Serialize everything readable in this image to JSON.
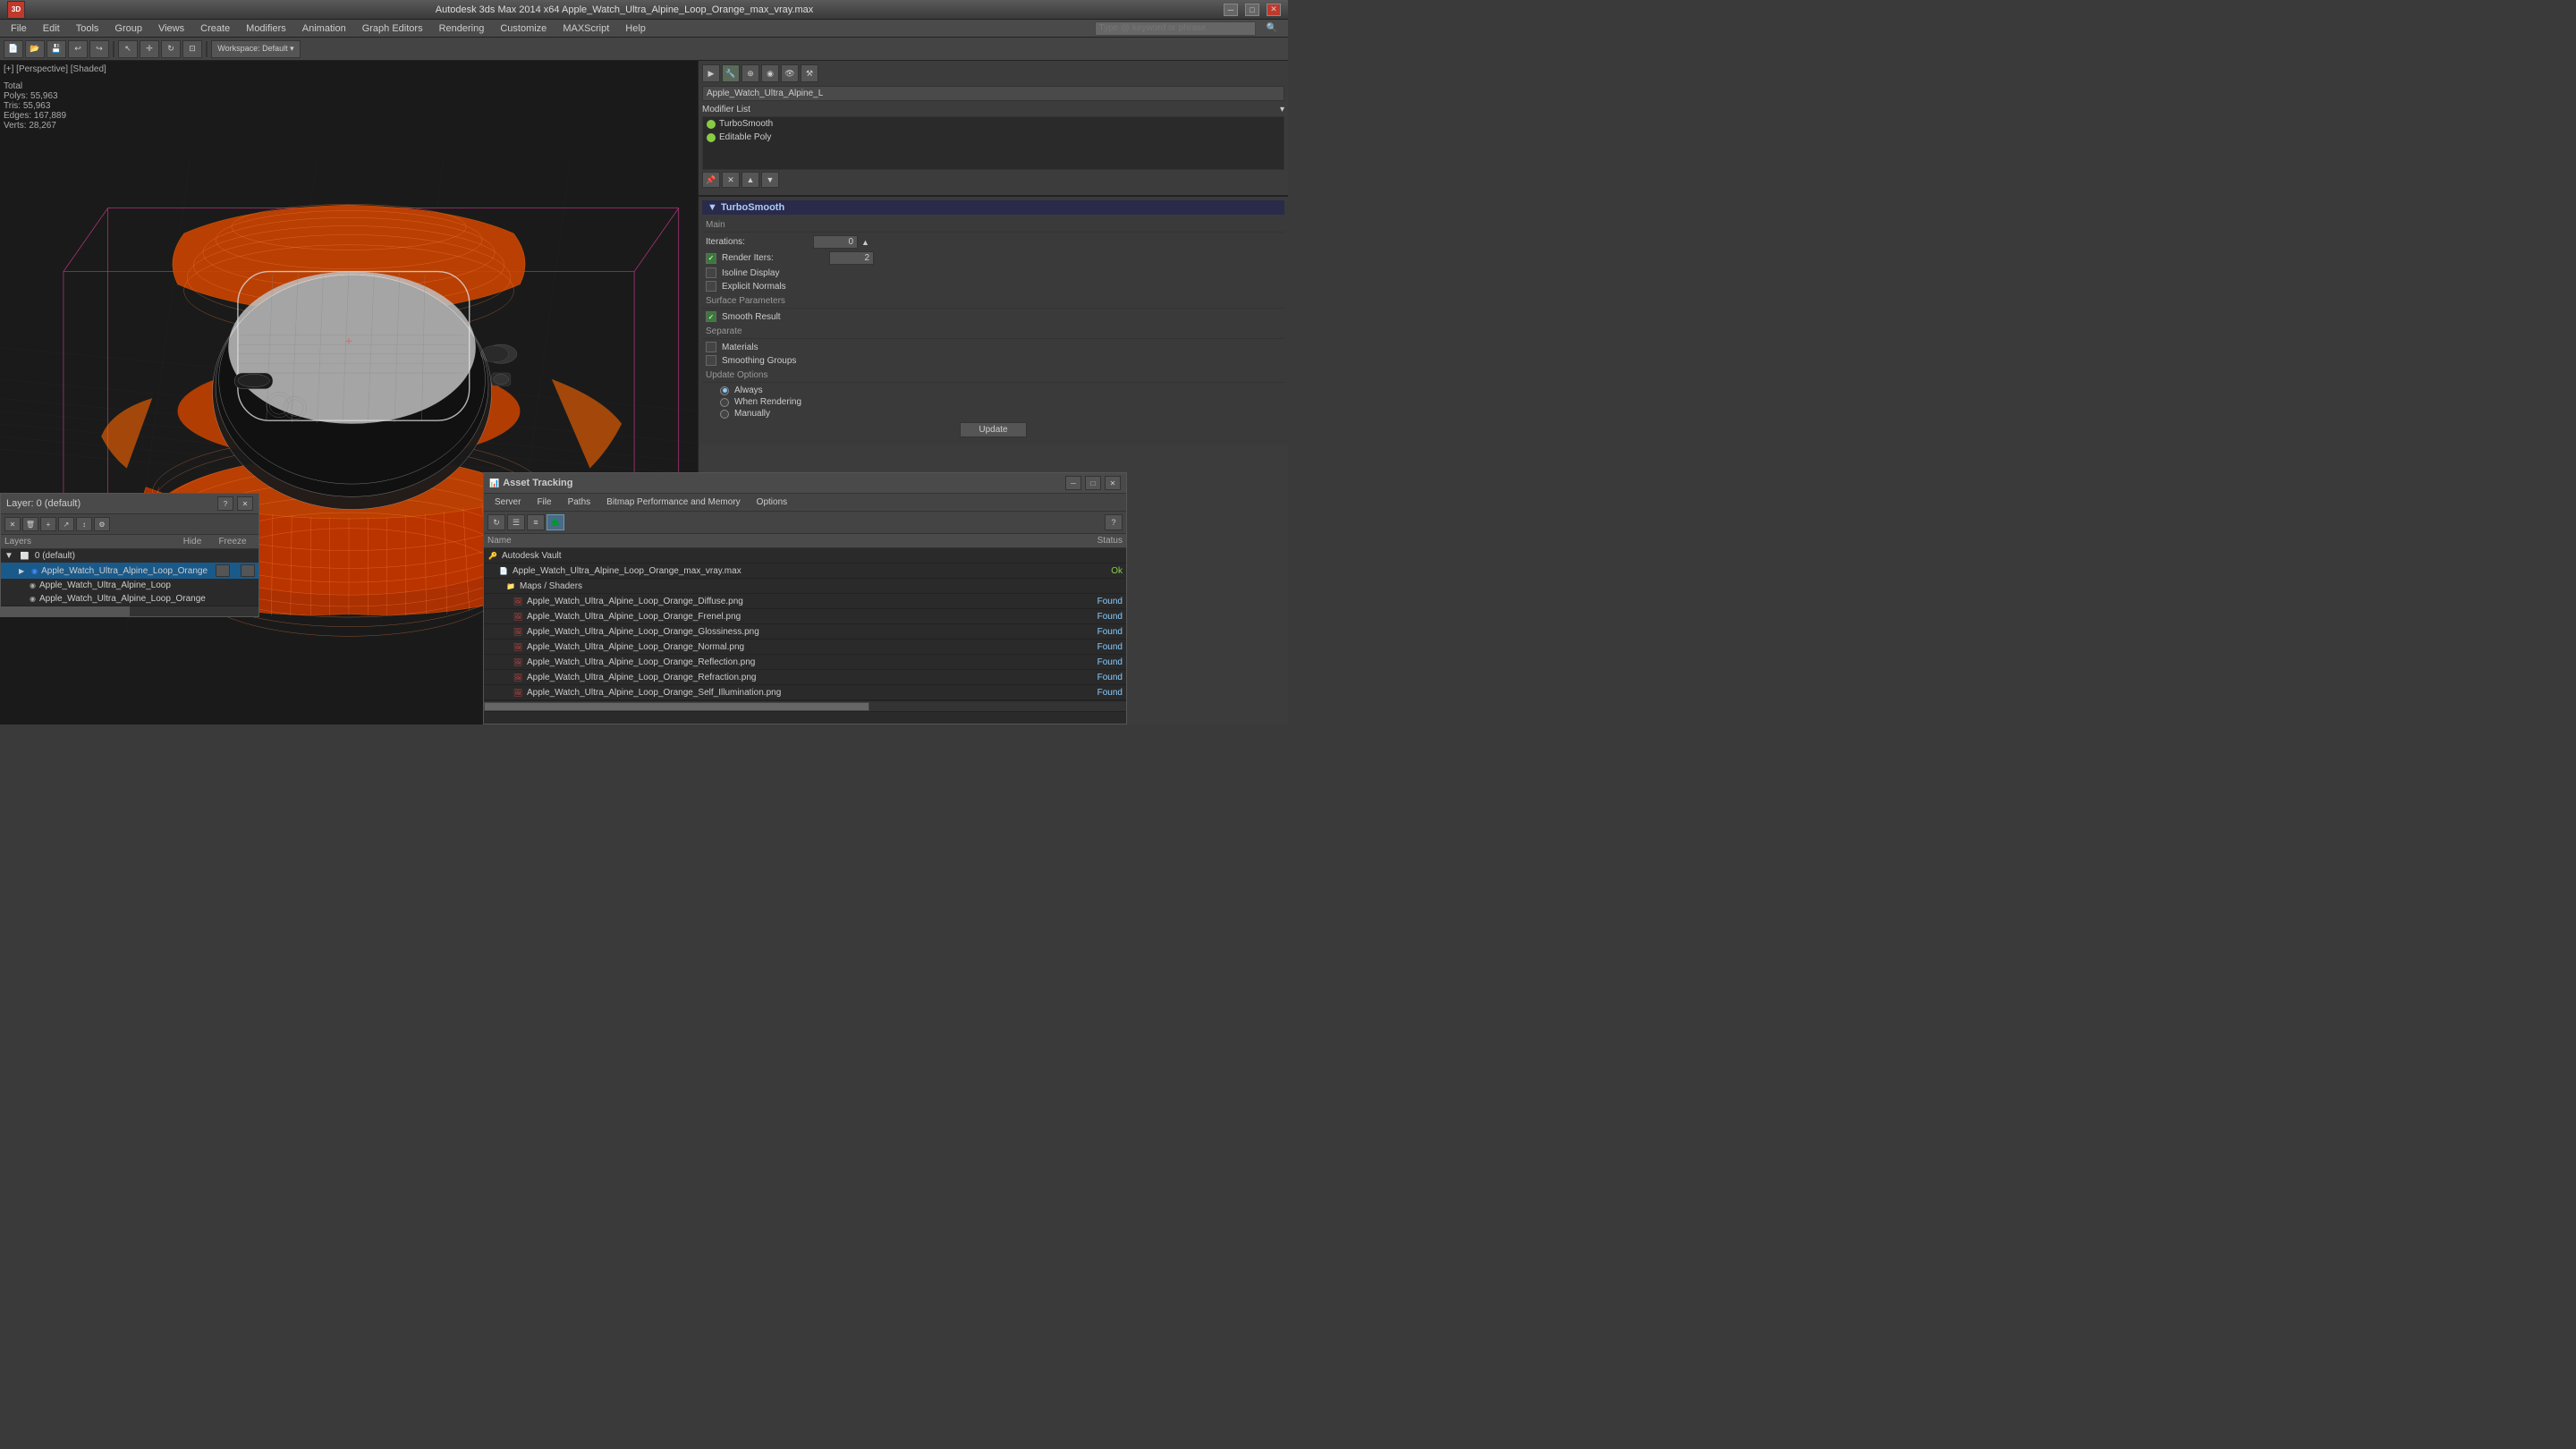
{
  "titleBar": {
    "appName": "Autodesk 3ds Max 2014 x64",
    "fileName": "Apple_Watch_Ultra_Alpine_Loop_Orange_max_vray.max",
    "fullTitle": "Autodesk 3ds Max 2014 x64   Apple_Watch_Ultra_Alpine_Loop_Orange_max_vray.max"
  },
  "menuBar": {
    "items": [
      "File",
      "Edit",
      "Tools",
      "Group",
      "Views",
      "Create",
      "Modifiers",
      "Animation",
      "Graph Editors",
      "Rendering",
      "Customize",
      "MAXScript",
      "Help"
    ]
  },
  "searchBar": {
    "placeholder": "Type @ keyword or phrase"
  },
  "viewport": {
    "label": "[+] [Perspective] [Shaded]",
    "stats": {
      "label": "Total",
      "polys": "Polys:  55,963",
      "tris": "Tris:   55,963",
      "edges": "Edges: 167,889",
      "verts": "Verts:  28,267"
    }
  },
  "rightPanel": {
    "fileName": "Apple_Watch_Ultra_Alpine_L",
    "modifierListLabel": "Modifier List",
    "modifiers": [
      {
        "name": "TurboSmooth",
        "enabled": true
      },
      {
        "name": "Editable Poly",
        "enabled": true
      }
    ],
    "turboSmooth": {
      "sectionTitle": "TurboSmooth",
      "mainLabel": "Main",
      "iterationsLabel": "Iterations:",
      "iterationsValue": "0",
      "renderItersLabel": "Render Iters:",
      "renderItersValue": "2",
      "renderItersChecked": true,
      "isoLineDisplay": "Isoline Display",
      "isoLineChecked": false,
      "explicitNormals": "Explicit Normals",
      "explicitNormalsChecked": false,
      "surfaceParamsLabel": "Surface Parameters",
      "smoothResult": "Smooth Result",
      "smoothResultChecked": true,
      "separateLabel": "Separate",
      "materials": "Materials",
      "materialsChecked": false,
      "smoothingGroups": "Smoothing Groups",
      "smoothingGroupsChecked": false,
      "updateOptionsLabel": "Update Options",
      "always": "Always",
      "whenRendering": "When Rendering",
      "manually": "Manually",
      "selectedUpdate": "Always",
      "updateBtn": "Update"
    }
  },
  "layerPanel": {
    "title": "Layer: 0 (default)",
    "columns": [
      "Layers",
      "Hide",
      "Freeze"
    ],
    "layers": [
      {
        "name": "0 (default)",
        "level": 0,
        "indent": false
      },
      {
        "name": "Apple_Watch_Ultra_Alpine_Loop_Orange",
        "level": 1,
        "indent": true,
        "selected": true
      },
      {
        "name": "Apple_Watch_Ultra_Alpine_Loop",
        "level": 2,
        "indent": true
      },
      {
        "name": "Apple_Watch_Ultra_Alpine_Loop_Orange",
        "level": 2,
        "indent": true
      }
    ]
  },
  "assetPanel": {
    "title": "Asset Tracking",
    "menuItems": [
      "Server",
      "File",
      "Paths",
      "Bitmap Performance and Memory",
      "Options"
    ],
    "columns": {
      "name": "Name",
      "status": "Status"
    },
    "rows": [
      {
        "type": "vault",
        "name": "Autodesk Vault",
        "status": "",
        "statusClass": "",
        "level": 0
      },
      {
        "type": "file",
        "name": "Apple_Watch_Ultra_Alpine_Loop_Orange_max_vray.max",
        "status": "Ok",
        "statusClass": "status-ok",
        "level": 1
      },
      {
        "type": "folder",
        "name": "Maps / Shaders",
        "status": "",
        "statusClass": "",
        "level": 2
      },
      {
        "type": "img",
        "name": "Apple_Watch_Ultra_Alpine_Loop_Orange_Diffuse.png",
        "status": "Found",
        "statusClass": "status-found",
        "level": 3
      },
      {
        "type": "img",
        "name": "Apple_Watch_Ultra_Alpine_Loop_Orange_Frenel.png",
        "status": "Found",
        "statusClass": "status-found",
        "level": 3
      },
      {
        "type": "img",
        "name": "Apple_Watch_Ultra_Alpine_Loop_Orange_Glossiness.png",
        "status": "Found",
        "statusClass": "status-found",
        "level": 3
      },
      {
        "type": "img",
        "name": "Apple_Watch_Ultra_Alpine_Loop_Orange_Normal.png",
        "status": "Found",
        "statusClass": "status-found",
        "level": 3
      },
      {
        "type": "img",
        "name": "Apple_Watch_Ultra_Alpine_Loop_Orange_Reflection.png",
        "status": "Found",
        "statusClass": "status-found",
        "level": 3
      },
      {
        "type": "img",
        "name": "Apple_Watch_Ultra_Alpine_Loop_Orange_Refraction.png",
        "status": "Found",
        "statusClass": "status-found",
        "level": 3
      },
      {
        "type": "img",
        "name": "Apple_Watch_Ultra_Alpine_Loop_Orange_Self_Illumination.png",
        "status": "Found",
        "statusClass": "status-found",
        "level": 3
      }
    ]
  }
}
